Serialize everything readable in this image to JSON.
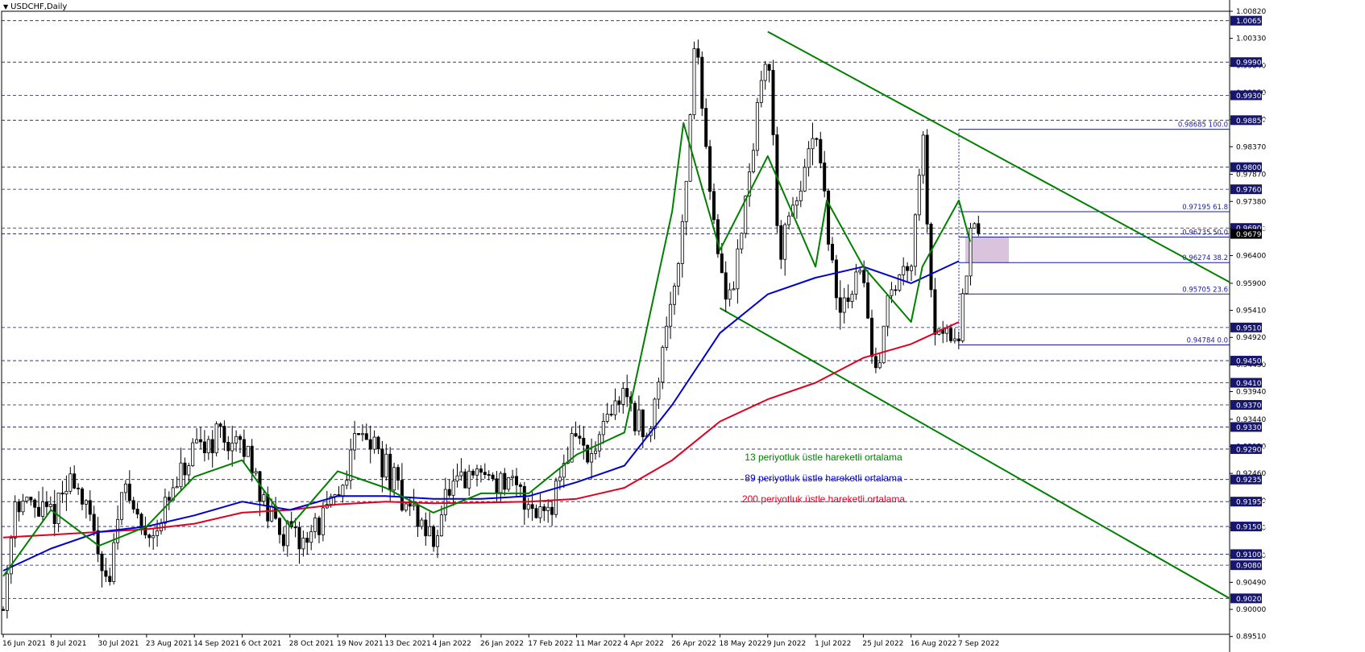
{
  "window": {
    "symbol_title": "USDCHF,Daily"
  },
  "colors": {
    "up_candle": "#ffffff",
    "down_candle": "#000000",
    "ema13": "#008000",
    "ema89": "#0000d0",
    "ema200": "#e00020",
    "channel": "#008000",
    "fib": "#1a1aa8",
    "fib_zone": "#d4b8d6",
    "gridline": "#1a1a60",
    "axis_badge": "#16166e"
  },
  "legend": [
    {
      "label": "13 periyotluk üstle hareketli ortalama",
      "color": "#008000"
    },
    {
      "label": "89 periyotluk üstle hareketli ortalama",
      "color": "#0000d0"
    },
    {
      "label": "200 periyotluk üstle hareketli ortalama",
      "color": "#e00020"
    }
  ],
  "chart_data": {
    "type": "candlestick",
    "symbol": "USDCHF",
    "timeframe": "Daily",
    "ylim": [
      0.8955,
      1.0082
    ],
    "price_axis_ticks": [
      "1.00820",
      "1.00330",
      "0.99840",
      "0.99350",
      "0.98860",
      "0.98370",
      "0.97870",
      "0.97380",
      "0.96890",
      "0.96400",
      "0.95900",
      "0.95410",
      "0.94920",
      "0.94430",
      "0.93940",
      "0.93440",
      "0.92950",
      "0.92460",
      "0.91970",
      "0.91480",
      "0.90980",
      "0.90490",
      "0.90000",
      "0.89510"
    ],
    "badge_levels": [
      "1.00650",
      "0.99900",
      "0.99300",
      "0.98850",
      "0.98000",
      "0.97600",
      "0.96900",
      "0.96793",
      "0.95100",
      "0.94500",
      "0.94100",
      "0.93700",
      "0.93300",
      "0.92900",
      "0.92350",
      "0.91950",
      "0.91500",
      "0.91000",
      "0.90800",
      "0.90200"
    ],
    "date_labels": [
      "16 Jun 2021",
      "8 Jul 2021",
      "30 Jul 2021",
      "23 Aug 2021",
      "14 Sep 2021",
      "6 Oct 2021",
      "28 Oct 2021",
      "19 Nov 2021",
      "13 Dec 2021",
      "4 Jan 2022",
      "26 Jan 2022",
      "17 Feb 2022",
      "11 Mar 2022",
      "4 Apr 2022",
      "26 Apr 2022",
      "18 May 2022",
      "9 Jun 2022",
      "1 Jul 2022",
      "25 Jul 2022",
      "16 Aug 2022",
      "7 Sep 2022"
    ],
    "fib_levels": [
      {
        "price": 0.98685,
        "label": "0.98685 100.0"
      },
      {
        "price": 0.97195,
        "label": "0.97195 61.8"
      },
      {
        "price": 0.96735,
        "label": "0.96735 50.0"
      },
      {
        "price": 0.96274,
        "label": "0.96274 38.2"
      },
      {
        "price": 0.95705,
        "label": "0.95705 23.6"
      },
      {
        "price": 0.94784,
        "label": "0.94784 0.0"
      }
    ],
    "channel": {
      "upper": {
        "from": [
          "9 Jun 2022",
          1.0045
        ],
        "to": [
          "axis edge",
          0.9592
        ]
      },
      "lower": {
        "from": [
          "18 May 2022",
          0.9545
        ],
        "to": [
          "axis edge",
          0.902
        ]
      }
    },
    "price_path": [
      {
        "date": "16 Jun 2021",
        "price": 0.9
      },
      {
        "date": "16 Jun 2021",
        "price": 0.92
      },
      {
        "date": "8 Jul 2021",
        "price": 0.924
      },
      {
        "date": "8 Jul 2021",
        "price": 0.917
      },
      {
        "date": "30 Jul 2021",
        "price": 0.905
      },
      {
        "date": "30 Jul 2021",
        "price": 0.923
      },
      {
        "date": "23 Aug 2021",
        "price": 0.913
      },
      {
        "date": "23 Aug 2021",
        "price": 0.916
      },
      {
        "date": "14 Sep 2021",
        "price": 0.932
      },
      {
        "date": "14 Sep 2021",
        "price": 0.928
      },
      {
        "date": "6 Oct 2021",
        "price": 0.927
      },
      {
        "date": "6 Oct 2021",
        "price": 0.918
      },
      {
        "date": "28 Oct 2021",
        "price": 0.913
      },
      {
        "date": "28 Oct 2021",
        "price": 0.912
      },
      {
        "date": "19 Nov 2021",
        "price": 0.934
      },
      {
        "date": "19 Nov 2021",
        "price": 0.92
      },
      {
        "date": "13 Dec 2021",
        "price": 0.922
      },
      {
        "date": "13 Dec 2021",
        "price": 0.919
      },
      {
        "date": "4 Jan 2022",
        "price": 0.912
      },
      {
        "date": "4 Jan 2022",
        "price": 0.92
      },
      {
        "date": "26 Jan 2022",
        "price": 0.923
      },
      {
        "date": "26 Jan 2022",
        "price": 0.925
      },
      {
        "date": "17 Feb 2022",
        "price": 0.918
      },
      {
        "date": "17 Feb 2022",
        "price": 0.92
      },
      {
        "date": "11 Mar 2022",
        "price": 0.933
      },
      {
        "date": "11 Mar 2022",
        "price": 0.926
      },
      {
        "date": "4 Apr 2022",
        "price": 0.93
      },
      {
        "date": "4 Apr 2022",
        "price": 0.94
      },
      {
        "date": "26 Apr 2022",
        "price": 0.97
      },
      {
        "date": "26 Apr 2022",
        "price": 1.004
      },
      {
        "date": "18 May 2022",
        "price": 0.96
      },
      {
        "date": "18 May 2022",
        "price": 0.957
      },
      {
        "date": "9 Jun 2022",
        "price": 0.97
      },
      {
        "date": "9 Jun 2022",
        "price": 1.003
      },
      {
        "date": "9 Jun 2022",
        "price": 0.964
      },
      {
        "date": "1 Jul 2022",
        "price": 0.953
      },
      {
        "date": "1 Jul 2022",
        "price": 0.986
      },
      {
        "date": "1 Jul 2022",
        "price": 0.97
      },
      {
        "date": "25 Jul 2022",
        "price": 0.955
      },
      {
        "date": "25 Jul 2022",
        "price": 0.962
      },
      {
        "date": "25 Jul 2022",
        "price": 0.94
      },
      {
        "date": "16 Aug 2022",
        "price": 0.951
      },
      {
        "date": "16 Aug 2022",
        "price": 0.964
      },
      {
        "date": "16 Aug 2022",
        "price": 0.986
      },
      {
        "date": "7 Sep 2022",
        "price": 0.97
      },
      {
        "date": "7 Sep 2022",
        "price": 0.95
      },
      {
        "date": "7 Sep 2022",
        "price": 0.9665
      }
    ],
    "ema13_path": [
      {
        "date": "16 Jun 2021",
        "price": 0.906
      },
      {
        "date": "8 Jul 2021",
        "price": 0.918
      },
      {
        "date": "30 Jul 2021",
        "price": 0.9115
      },
      {
        "date": "23 Aug 2021",
        "price": 0.915
      },
      {
        "date": "14 Sep 2021",
        "price": 0.924
      },
      {
        "date": "6 Oct 2021",
        "price": 0.927
      },
      {
        "date": "28 Oct 2021",
        "price": 0.915
      },
      {
        "date": "19 Nov 2021",
        "price": 0.925
      },
      {
        "date": "13 Dec 2021",
        "price": 0.922
      },
      {
        "date": "4 Jan 2022",
        "price": 0.9175
      },
      {
        "date": "26 Jan 2022",
        "price": 0.921
      },
      {
        "date": "17 Feb 2022",
        "price": 0.921
      },
      {
        "date": "11 Mar 2022",
        "price": 0.928
      },
      {
        "date": "4 Apr 2022",
        "price": 0.932
      },
      {
        "date": "26 Apr 2022",
        "price": 0.972
      },
      {
        "date": "26 Apr 2022",
        "price": 0.988
      },
      {
        "date": "18 May 2022",
        "price": 0.965
      },
      {
        "date": "9 Jun 2022",
        "price": 0.982
      },
      {
        "date": "1 Jul 2022",
        "price": 0.962
      },
      {
        "date": "1 Jul 2022",
        "price": 0.974
      },
      {
        "date": "25 Jul 2022",
        "price": 0.962
      },
      {
        "date": "16 Aug 2022",
        "price": 0.952
      },
      {
        "date": "16 Aug 2022",
        "price": 0.962
      },
      {
        "date": "7 Sep 2022",
        "price": 0.974
      },
      {
        "date": "7 Sep 2022",
        "price": 0.9665
      }
    ],
    "ema89_path": [
      {
        "date": "16 Jun 2021",
        "price": 0.907
      },
      {
        "date": "8 Jul 2021",
        "price": 0.911
      },
      {
        "date": "30 Jul 2021",
        "price": 0.914
      },
      {
        "date": "23 Aug 2021",
        "price": 0.915
      },
      {
        "date": "14 Sep 2021",
        "price": 0.917
      },
      {
        "date": "6 Oct 2021",
        "price": 0.9195
      },
      {
        "date": "28 Oct 2021",
        "price": 0.918
      },
      {
        "date": "19 Nov 2021",
        "price": 0.9205
      },
      {
        "date": "13 Dec 2021",
        "price": 0.9205
      },
      {
        "date": "4 Jan 2022",
        "price": 0.92
      },
      {
        "date": "26 Jan 2022",
        "price": 0.92
      },
      {
        "date": "17 Feb 2022",
        "price": 0.9205
      },
      {
        "date": "11 Mar 2022",
        "price": 0.923
      },
      {
        "date": "4 Apr 2022",
        "price": 0.926
      },
      {
        "date": "26 Apr 2022",
        "price": 0.937
      },
      {
        "date": "18 May 2022",
        "price": 0.95
      },
      {
        "date": "9 Jun 2022",
        "price": 0.957
      },
      {
        "date": "1 Jul 2022",
        "price": 0.96
      },
      {
        "date": "25 Jul 2022",
        "price": 0.962
      },
      {
        "date": "16 Aug 2022",
        "price": 0.959
      },
      {
        "date": "7 Sep 2022",
        "price": 0.963
      }
    ],
    "ema200_path": [
      {
        "date": "16 Jun 2021",
        "price": 0.913
      },
      {
        "date": "8 Jul 2021",
        "price": 0.9135
      },
      {
        "date": "30 Jul 2021",
        "price": 0.914
      },
      {
        "date": "23 Aug 2021",
        "price": 0.9145
      },
      {
        "date": "14 Sep 2021",
        "price": 0.9155
      },
      {
        "date": "6 Oct 2021",
        "price": 0.9175
      },
      {
        "date": "28 Oct 2021",
        "price": 0.918
      },
      {
        "date": "19 Nov 2021",
        "price": 0.919
      },
      {
        "date": "13 Dec 2021",
        "price": 0.9195
      },
      {
        "date": "4 Jan 2022",
        "price": 0.9192
      },
      {
        "date": "26 Jan 2022",
        "price": 0.9193
      },
      {
        "date": "17 Feb 2022",
        "price": 0.9195
      },
      {
        "date": "11 Mar 2022",
        "price": 0.92
      },
      {
        "date": "4 Apr 2022",
        "price": 0.922
      },
      {
        "date": "26 Apr 2022",
        "price": 0.927
      },
      {
        "date": "18 May 2022",
        "price": 0.934
      },
      {
        "date": "9 Jun 2022",
        "price": 0.938
      },
      {
        "date": "1 Jul 2022",
        "price": 0.941
      },
      {
        "date": "25 Jul 2022",
        "price": 0.9455
      },
      {
        "date": "16 Aug 2022",
        "price": 0.948
      },
      {
        "date": "7 Sep 2022",
        "price": 0.952
      }
    ]
  }
}
